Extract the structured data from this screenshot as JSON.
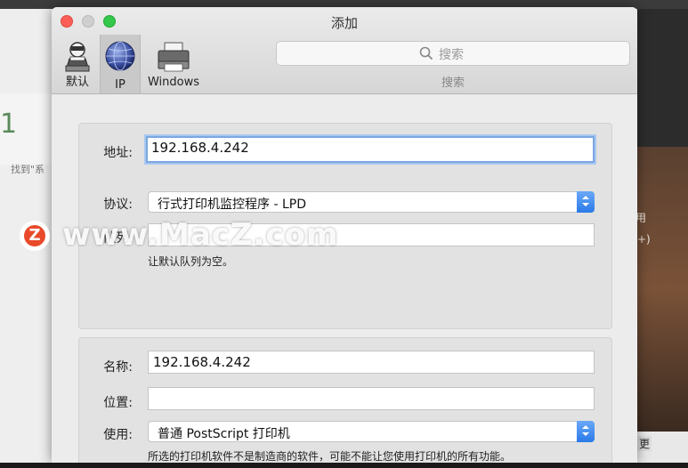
{
  "window": {
    "title": "添加"
  },
  "toolbar": {
    "items": [
      {
        "label": "默认",
        "icon": "default-printer-icon"
      },
      {
        "label": "IP",
        "icon": "ip-globe-icon",
        "selected": true
      },
      {
        "label": "Windows",
        "icon": "windows-printer-icon"
      }
    ],
    "search": {
      "placeholder": "搜索",
      "label": "搜索"
    }
  },
  "form": {
    "address": {
      "label": "地址:",
      "value": "192.168.4.242"
    },
    "protocol": {
      "label": "协议:",
      "value": "行式打印机监控程序 - LPD"
    },
    "queue": {
      "label": "队列:",
      "value": "",
      "hint": "让默认队列为空。"
    },
    "name": {
      "label": "名称:",
      "value": "192.168.4.242"
    },
    "location": {
      "label": "位置:",
      "value": ""
    },
    "use": {
      "label": "使用:",
      "value": "普通 PostScript 打印机",
      "hint": "所选的打印机软件不是制造商的软件，可能不能让您使用打印机的所有功能。"
    }
  },
  "watermark": {
    "text": "www.MacZ.com",
    "logo_letter": "Z"
  },
  "background": {
    "left_number": "1",
    "left_text": "找到\"系",
    "right_labels": [
      "用",
      "+)",
      "更"
    ]
  },
  "colors": {
    "accent": "#2a7ae8",
    "focus_ring": "#7aa8e0",
    "close": "#fc5f57",
    "zoom": "#34c84a",
    "watermark_logo": "#e84a2a"
  }
}
